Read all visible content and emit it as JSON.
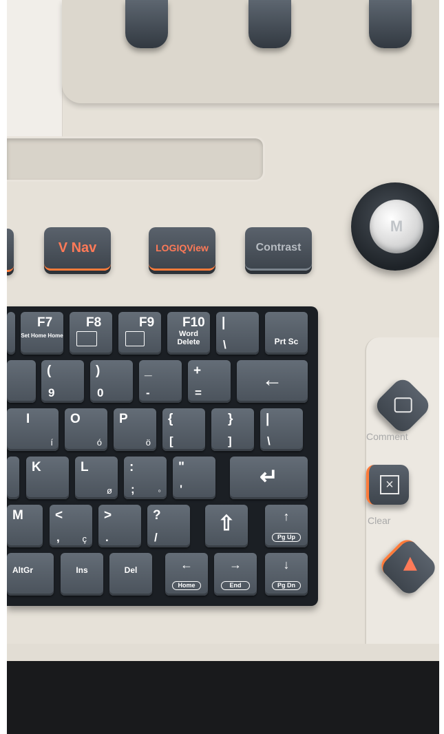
{
  "top_buttons": {
    "v_nav": "V Nav",
    "logiqview": "LOGIQView",
    "contrast": "Contrast"
  },
  "trackball": {
    "label": "M"
  },
  "keyboard": {
    "row1": {
      "f7": "F7",
      "f7_sub": "Set Home Home",
      "f8": "F8",
      "f9": "F9",
      "f10": "F10",
      "f10_sub": "Word Delete",
      "pipe_top": "|",
      "pipe_bottom": "\\",
      "prtsc": "Prt Sc"
    },
    "row2": {
      "k9_top": "(",
      "k9_bottom": "9",
      "k0_top": ")",
      "k0_bottom": "0",
      "minus_top": "_",
      "minus_bottom": "-",
      "plus_top": "+",
      "plus_bottom": "=",
      "backspace": "←"
    },
    "row3": {
      "i": "I",
      "i_alt": "í",
      "o": "O",
      "o_alt": "ó",
      "p": "P",
      "p_alt": "ö",
      "lbrace_top": "{",
      "lbrace_bottom": "[",
      "rbrace_top": "}",
      "rbrace_bottom": "]",
      "backslash_top": "|",
      "backslash_bottom": "\\"
    },
    "row4": {
      "k": "K",
      "l": "L",
      "l_alt": "ø",
      "colon_top": ":",
      "colon_bottom": ";",
      "colon_alt": "◦",
      "quote_top": "\"",
      "quote_bottom": "'",
      "enter": "↵"
    },
    "row5": {
      "m": "M",
      "lt_top": "<",
      "lt_bottom": ",",
      "lt_alt": "ç",
      "gt_top": ">",
      "gt_bottom": ".",
      "question_top": "?",
      "question_bottom": "/",
      "shift": "⇧",
      "pgup_arrow": "↑",
      "pgup": "Pg Up"
    },
    "row6": {
      "altgr": "AltGr",
      "ins": "Ins",
      "del": "Del",
      "left_arrow": "←",
      "home": "Home",
      "right_arrow": "→",
      "end": "End",
      "down_arrow": "↓",
      "pgdn": "Pg Dn"
    }
  },
  "side_buttons": {
    "comment": "Comment",
    "clear": "Clear"
  },
  "colors": {
    "accent": "#ff7a58",
    "key": "#555d66",
    "console": "#e6e1d8"
  }
}
